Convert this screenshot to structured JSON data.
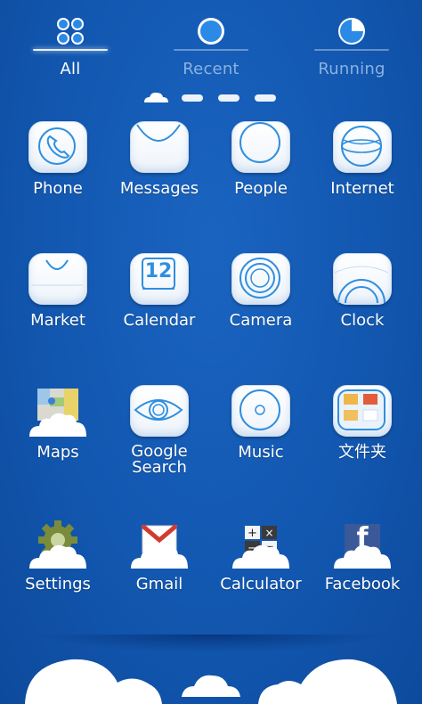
{
  "tabs": [
    {
      "label": "All",
      "icon": "grid-dots-icon",
      "active": true
    },
    {
      "label": "Recent",
      "icon": "circle-icon",
      "active": false
    },
    {
      "label": "Running",
      "icon": "pie-clock-icon",
      "active": false
    }
  ],
  "pager": {
    "pages": 4,
    "current": 1
  },
  "apps": [
    {
      "label": "Phone",
      "icon": "phone-icon"
    },
    {
      "label": "Messages",
      "icon": "messages-icon"
    },
    {
      "label": "People",
      "icon": "people-icon"
    },
    {
      "label": "Internet",
      "icon": "globe-icon"
    },
    {
      "label": "Market",
      "icon": "shopping-bag-icon"
    },
    {
      "label": "Calendar",
      "icon": "calendar-icon",
      "badge": "12"
    },
    {
      "label": "Camera",
      "icon": "camera-lens-icon"
    },
    {
      "label": "Clock",
      "icon": "clock-icon"
    },
    {
      "label": "Maps",
      "icon": "maps-icon"
    },
    {
      "label": "Google\nSearch",
      "icon": "eye-search-icon"
    },
    {
      "label": "Music",
      "icon": "music-disc-icon"
    },
    {
      "label": "文件夹",
      "icon": "folder-icon"
    },
    {
      "label": "Settings",
      "icon": "gear-icon"
    },
    {
      "label": "Gmail",
      "icon": "gmail-icon"
    },
    {
      "label": "Calculator",
      "icon": "calculator-icon"
    },
    {
      "label": "Facebook",
      "icon": "facebook-icon",
      "glyph": "f"
    }
  ],
  "colors": {
    "background": "#1257b0",
    "tile": "#ffffff",
    "tile_stroke": "#2f8fe0",
    "inactive_text": "#8cb2e0"
  }
}
